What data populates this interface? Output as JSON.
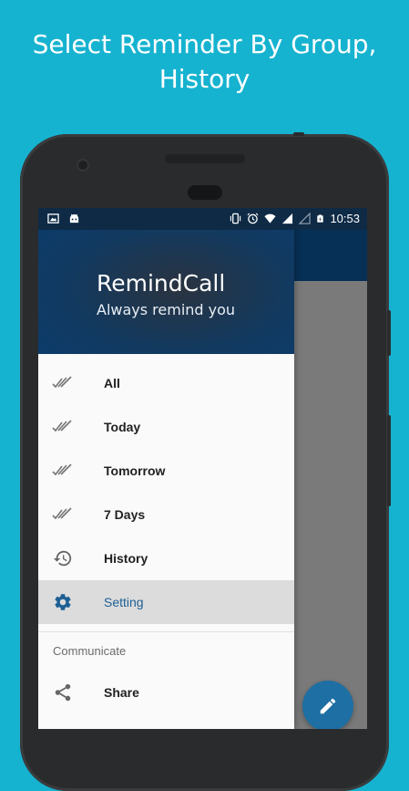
{
  "headline": {
    "line1": "Select Reminder By Group,",
    "line2": "History"
  },
  "status_bar": {
    "time": "10:53",
    "icons": [
      "image-icon",
      "android-icon",
      "vibrate-icon",
      "alarm-icon",
      "wifi-icon",
      "signal-icon",
      "signal-empty-icon",
      "battery-icon"
    ]
  },
  "drawer": {
    "app_name": "RemindCall",
    "tagline": "Always remind you",
    "items": [
      {
        "label": "All",
        "icon": "double-check-icon"
      },
      {
        "label": "Today",
        "icon": "double-check-icon"
      },
      {
        "label": "Tomorrow",
        "icon": "double-check-icon"
      },
      {
        "label": "7 Days",
        "icon": "double-check-icon"
      },
      {
        "label": "History",
        "icon": "history-icon"
      },
      {
        "label": "Setting",
        "icon": "gear-icon",
        "active": true
      }
    ],
    "section_title": "Communicate",
    "communicate_items": [
      {
        "label": "Share",
        "icon": "share-icon"
      }
    ]
  },
  "fab": {
    "icon": "pencil-icon"
  },
  "colors": {
    "background": "#16b3d0",
    "app_bar": "#073056",
    "accent": "#1d5f94",
    "fab": "#1e6fa3",
    "active_row": "#dcdcdc"
  }
}
